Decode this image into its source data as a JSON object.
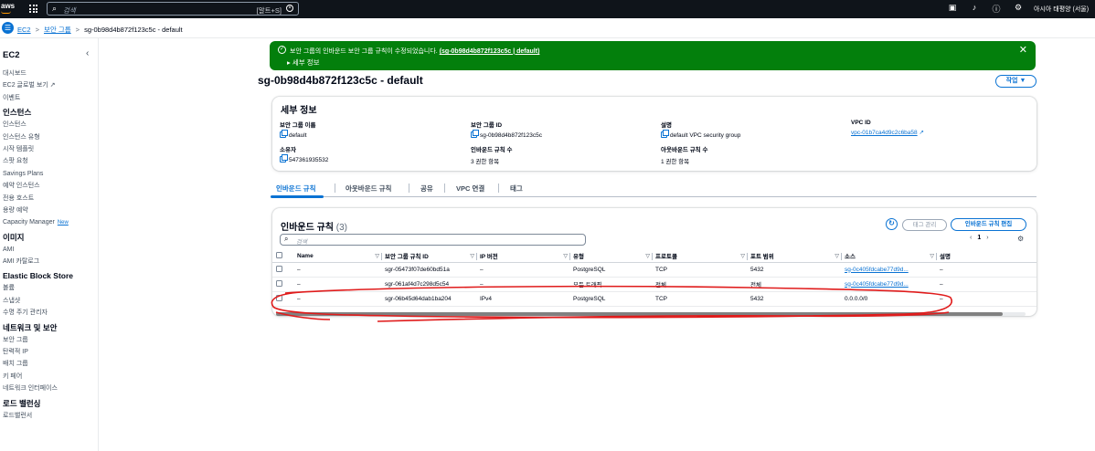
{
  "topbar": {
    "logo": "aws",
    "search_placeholder": "검색",
    "shortcut": "[알트+S]",
    "region": "아시아 태평양 (서울)",
    "colors": {
      "bg": "#0f141a",
      "accent": "#ff9900"
    }
  },
  "breadcrumb": {
    "ec2": "EC2",
    "sg": "보안 그룹",
    "current": "sg-0b98d4b872f123c5c - default"
  },
  "sidebar": {
    "title": "EC2",
    "items": [
      {
        "label": "대시보드"
      },
      {
        "label": "EC2 글로벌 보기 ↗"
      },
      {
        "label": "이벤트"
      },
      {
        "label": "인스턴스",
        "header": true
      },
      {
        "label": "인스턴스"
      },
      {
        "label": "인스턴스 유형"
      },
      {
        "label": "시작 템플릿"
      },
      {
        "label": "스팟 요청"
      },
      {
        "label": "Savings Plans"
      },
      {
        "label": "예약 인스턴스"
      },
      {
        "label": "전용 호스트"
      },
      {
        "label": "용량 예약"
      },
      {
        "label": "Capacity Manager",
        "badge": "New"
      },
      {
        "label": "이미지",
        "header": true
      },
      {
        "label": "AMI"
      },
      {
        "label": "AMI 카탈로그"
      },
      {
        "label": "Elastic Block Store",
        "header": true
      },
      {
        "label": "볼륨"
      },
      {
        "label": "스냅샷"
      },
      {
        "label": "수명 주기 관리자"
      },
      {
        "label": "네트워크 및 보안",
        "header": true
      },
      {
        "label": "보안 그룹"
      },
      {
        "label": "탄력적 IP"
      },
      {
        "label": "배치 그룹"
      },
      {
        "label": "키 페어"
      },
      {
        "label": "네트워크 인터페이스"
      },
      {
        "label": "로드 밸런싱",
        "header": true
      },
      {
        "label": "로드밸런서"
      }
    ]
  },
  "flash": {
    "message": "보안 그룹의 인바운드 보안 그룹 규칙이 수정되었습니다.",
    "link": "(sg-0b98d4b872f123c5c | default)",
    "expand": "세부 정보",
    "color": "#037f0c"
  },
  "page": {
    "title": "sg-0b98d4b872f123c5c - default",
    "actions": "작업"
  },
  "details": {
    "heading": "세부 정보",
    "sg_name_label": "보안 그룹 이름",
    "sg_name": "default",
    "sg_id_label": "보안 그룹 ID",
    "sg_id": "sg-0b98d4b872f123c5c",
    "desc_label": "설명",
    "desc": "default VPC security group",
    "vpc_label": "VPC ID",
    "vpc": "vpc-01b7ca4d9c2c6ba58",
    "owner_label": "소유자",
    "owner": "547361935532",
    "inbound_count_label": "인바운드 규칙 수",
    "inbound_count": "3 권한 항목",
    "outbound_count_label": "아웃바운드 규칙 수",
    "outbound_count": "1 권한 항목"
  },
  "tabs": [
    "인바운드 규칙",
    "아웃바운드 규칙",
    "공유",
    "VPC 연결",
    "태그"
  ],
  "rules": {
    "heading": "인바운드 규칙",
    "count": "(3)",
    "manage_tags": "태그 관리",
    "edit": "인바운드 규칙 편집",
    "search_placeholder": "검색",
    "page": "1",
    "columns": [
      "Name",
      "보안 그룹 규칙 ID",
      "IP 버전",
      "유형",
      "프로토콜",
      "포트 범위",
      "소스",
      "설명"
    ],
    "rows": [
      {
        "name": "–",
        "id": "sgr-05473f07de60bd51a",
        "ip": "–",
        "type": "PostgreSQL",
        "proto": "TCP",
        "port": "5432",
        "source": "sg-0c405fdcabe77d9d...",
        "desc": "–",
        "source_link": true
      },
      {
        "name": "–",
        "id": "sgr-061af4d7c298d5c54",
        "ip": "–",
        "type": "모든 트래픽",
        "proto": "전체",
        "port": "전체",
        "source": "sg-0c405fdcabe77d9d...",
        "desc": "–",
        "source_link": true
      },
      {
        "name": "–",
        "id": "sgr-06b45d64dab1ba204",
        "ip": "IPv4",
        "type": "PostgreSQL",
        "proto": "TCP",
        "port": "5432",
        "source": "0.0.0.0/0",
        "desc": "–",
        "source_link": false
      }
    ]
  }
}
